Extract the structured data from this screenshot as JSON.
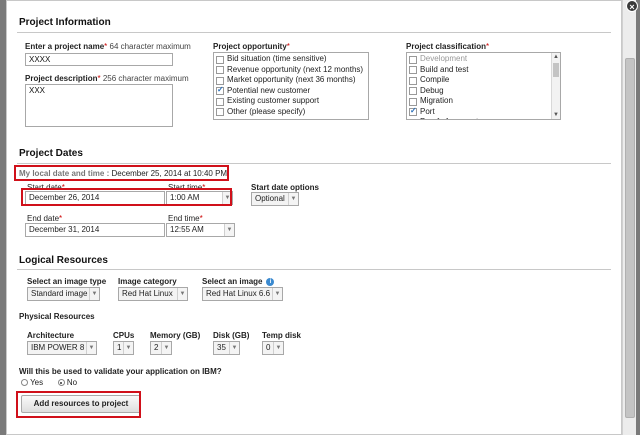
{
  "project_info": {
    "title": "Project Information",
    "name_label": "Enter a project name",
    "name_hint": " 64 character maximum",
    "name_value": "XXXX",
    "desc_label": "Project description",
    "desc_hint": " 256 character maximum",
    "desc_value": "XXX",
    "opportunity_label": "Project opportunity",
    "opportunity_items": [
      {
        "label": "Bid situation (time sensitive)",
        "checked": false
      },
      {
        "label": "Revenue opportunity (next 12 months)",
        "checked": false
      },
      {
        "label": "Market opportunity (next 36 months)",
        "checked": false
      },
      {
        "label": "Potential new customer",
        "checked": true
      },
      {
        "label": "Existing customer support",
        "checked": false
      },
      {
        "label": "Other (please specify)",
        "checked": false
      }
    ],
    "classification_label": "Project classification",
    "classification_items": [
      {
        "label": "Development",
        "checked": false,
        "disabled": true
      },
      {
        "label": "Build and test",
        "checked": false,
        "disabled": false
      },
      {
        "label": "Compile",
        "checked": false,
        "disabled": false
      },
      {
        "label": "Debug",
        "checked": false,
        "disabled": false
      },
      {
        "label": "Migration",
        "checked": false,
        "disabled": false
      },
      {
        "label": "Port",
        "checked": true,
        "disabled": false
      },
      {
        "label": "Proof of concept",
        "checked": false,
        "disabled": false
      }
    ]
  },
  "project_dates": {
    "title": "Project Dates",
    "local_dt_label": "My local date and time : ",
    "local_dt_value": "December 25, 2014 at 10:40 PM",
    "start_date_label": "Start date",
    "start_date_value": "December 26, 2014",
    "start_time_label": "Start time",
    "start_time_value": "1:00 AM",
    "start_options_label": "Start date options",
    "start_options_value": "Optional",
    "end_date_label": "End date",
    "end_date_value": "December 31, 2014",
    "end_time_label": "End time",
    "end_time_value": "12:55 AM"
  },
  "logical_resources": {
    "title": "Logical Resources",
    "image_type_label": "Select an image type",
    "image_type_value": "Standard image",
    "image_category_label": "Image category",
    "image_category_value": "Red Hat Linux",
    "select_image_label": "Select an image",
    "select_image_value": "Red Hat Linux 6.6",
    "physical_title": "Physical Resources",
    "arch_label": "Architecture",
    "arch_value": "IBM POWER 8",
    "cpus_label": "CPUs",
    "cpus_value": "1",
    "memory_label": "Memory (GB)",
    "memory_value": "2",
    "disk_label": "Disk (GB)",
    "disk_value": "35",
    "temp_label": "Temp disk",
    "temp_value": "0",
    "validate_question": "Will this be used to validate your application on IBM?",
    "yes_label": "Yes",
    "no_label": "No",
    "add_button": "Add resources to project"
  },
  "req_mark": "*",
  "close_label": "×",
  "info_icon": "i",
  "caret": "▼"
}
